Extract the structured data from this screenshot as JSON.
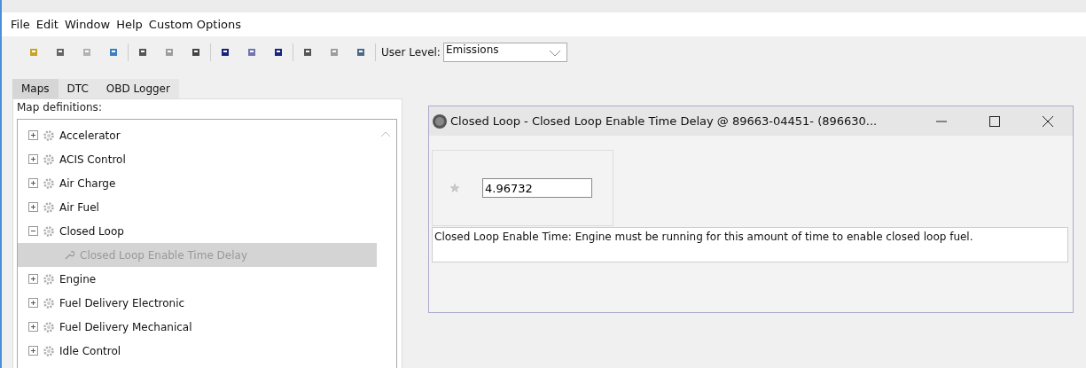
{
  "menu": [
    "File",
    "Edit",
    "Window",
    "Help",
    "Custom Options"
  ],
  "toolbar": {
    "user_level_label": "User Level:",
    "user_level": "Emissions"
  },
  "tabs": [
    {
      "label": "Maps",
      "selected": true
    },
    {
      "label": "DTC",
      "selected": false
    },
    {
      "label": "OBD Logger",
      "selected": false
    }
  ],
  "map_definitions": {
    "title": "Map definitions:",
    "tree": [
      {
        "label": "Accelerator",
        "expanded": false
      },
      {
        "label": "ACIS Control",
        "expanded": false
      },
      {
        "label": "Air Charge",
        "expanded": false
      },
      {
        "label": "Air Fuel",
        "expanded": false
      },
      {
        "label": "Closed Loop",
        "expanded": true,
        "children": [
          {
            "label": "Closed Loop Enable Time Delay",
            "selected": true
          }
        ]
      },
      {
        "label": "Engine",
        "expanded": false
      },
      {
        "label": "Fuel Delivery Electronic",
        "expanded": false
      },
      {
        "label": "Fuel Delivery Mechanical",
        "expanded": false
      },
      {
        "label": "Idle Control",
        "expanded": false
      }
    ]
  },
  "dialog": {
    "title": "Closed Loop - Closed Loop Enable Time Delay @ 89663-04451- (896630...",
    "value": "4.96732",
    "description": "Closed Loop Enable Time: Engine must be running for this amount of time to enable closed loop fuel."
  }
}
